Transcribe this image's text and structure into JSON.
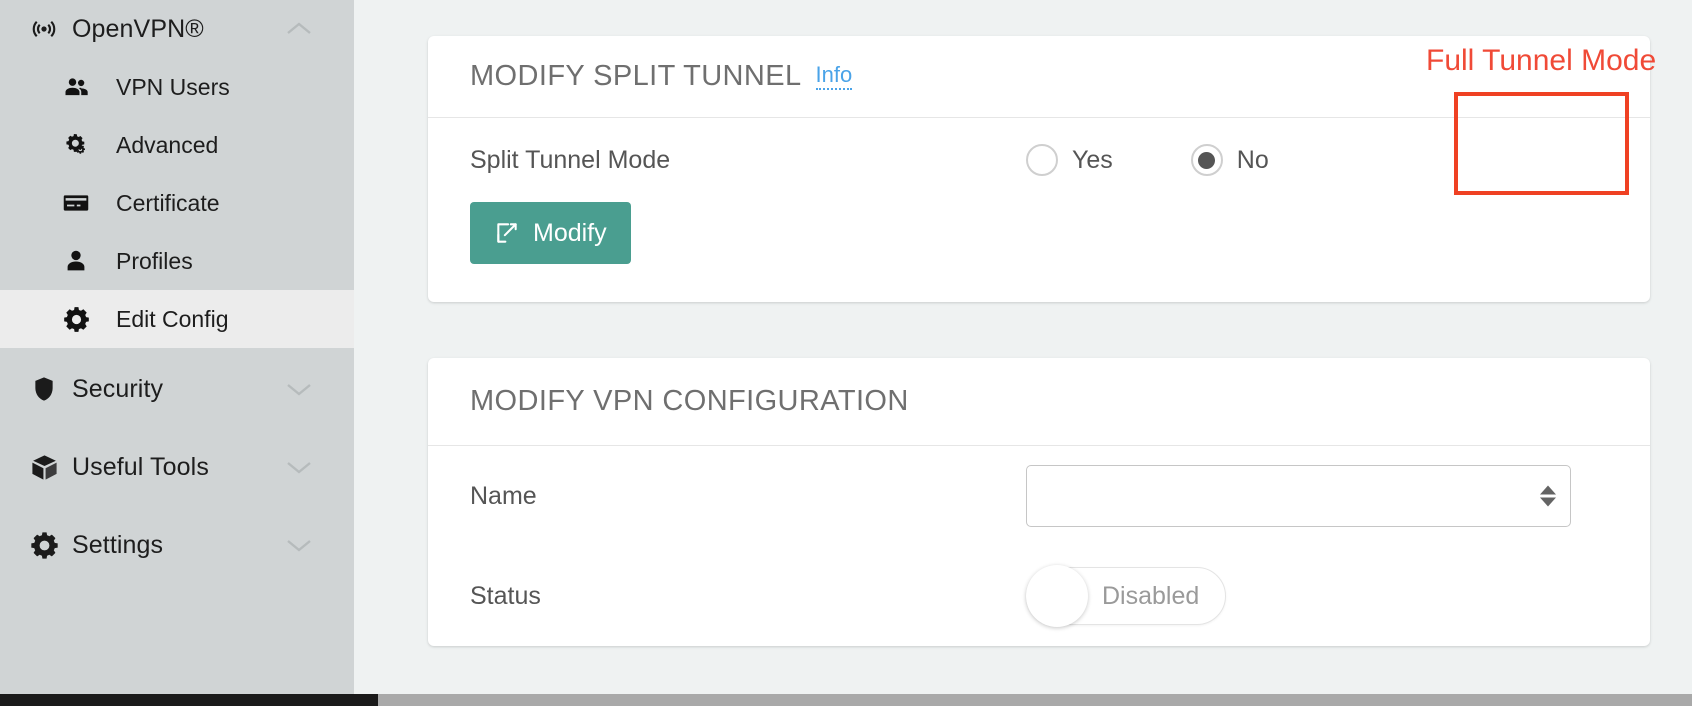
{
  "sidebar": {
    "groups": [
      {
        "label": "OpenVPN®",
        "icon": "broadcast-icon",
        "chevron": "chevron-up-icon",
        "items": [
          {
            "label": "VPN Users",
            "icon": "users-icon"
          },
          {
            "label": "Advanced",
            "icon": "gears-icon"
          },
          {
            "label": "Certificate",
            "icon": "card-icon"
          },
          {
            "label": "Profiles",
            "icon": "person-icon"
          },
          {
            "label": "Edit Config",
            "icon": "gear-icon",
            "active": true
          }
        ]
      },
      {
        "label": "Security",
        "icon": "shield-icon",
        "chevron": "chevron-down-icon",
        "items": []
      },
      {
        "label": "Useful Tools",
        "icon": "box-icon",
        "chevron": "chevron-down-icon",
        "items": []
      },
      {
        "label": "Settings",
        "icon": "gear-icon",
        "chevron": "chevron-down-icon",
        "items": []
      }
    ]
  },
  "split_tunnel_card": {
    "title": "MODIFY SPLIT TUNNEL",
    "info_link": "Info",
    "row_label": "Split Tunnel Mode",
    "options": [
      {
        "label": "Yes",
        "selected": false
      },
      {
        "label": "No",
        "selected": true
      }
    ],
    "modify_button": "Modify"
  },
  "vpn_config_card": {
    "title": "MODIFY VPN CONFIGURATION",
    "name_label": "Name",
    "name_value": "",
    "status_label": "Status",
    "status_toggle_text": "Disabled",
    "status_enabled": false
  },
  "annotations": {
    "full_tunnel_mode": "Full Tunnel Mode",
    "color": "#f04a37",
    "highlight_color": "#ef4123"
  },
  "colors": {
    "sidebar_bg": "#d0d4d5",
    "sidebar_active": "#ececec",
    "page_bg": "#eff2f2",
    "card_bg": "#ffffff",
    "accent_teal": "#4a9e90",
    "link_blue": "#4aa3e8",
    "title_gray": "#6f6f6f"
  }
}
